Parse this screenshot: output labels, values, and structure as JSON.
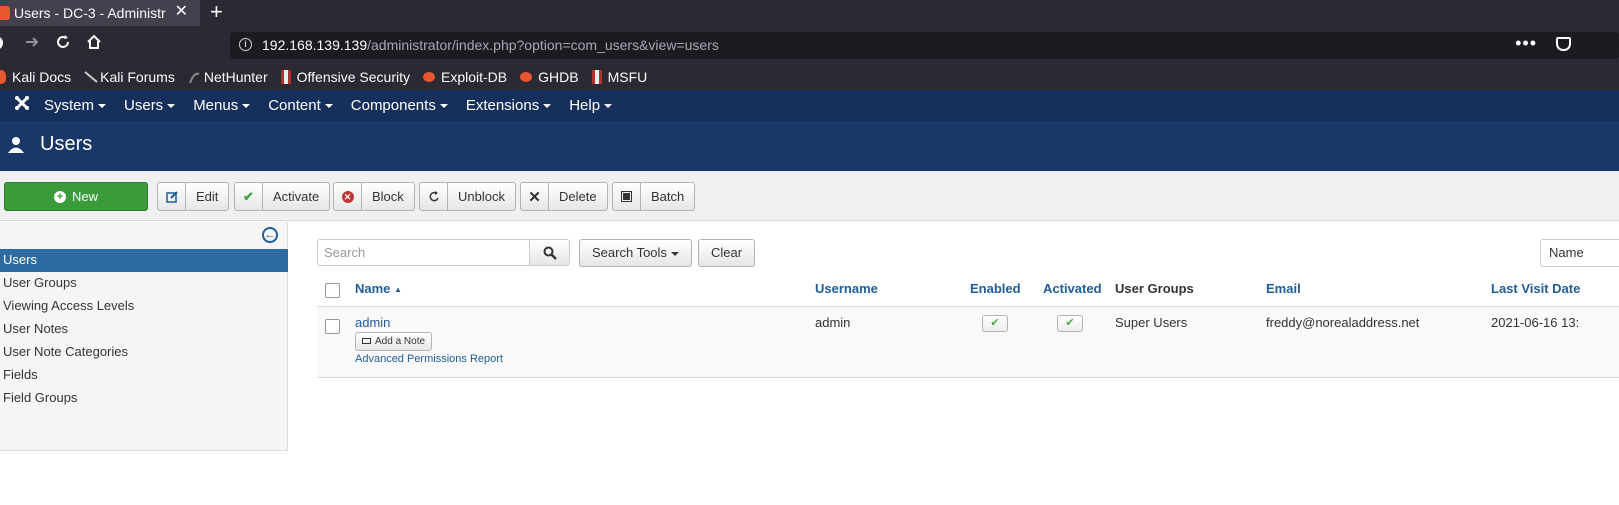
{
  "browser": {
    "tab_title": "Users - DC-3 - Administr",
    "tab_close": "✕",
    "new_tab": "+",
    "url_host": "192.168.139.139",
    "url_path": "/administrator/index.php?option=com_users&view=users",
    "bookmarks": [
      {
        "label": "Kali Docs",
        "color": "#e8572f"
      },
      {
        "label": "Kali Forums",
        "color": "#cccccc"
      },
      {
        "label": "NetHunter",
        "color": "#888888"
      },
      {
        "label": "Offensive Security",
        "color": "#b03030"
      },
      {
        "label": "Exploit-DB",
        "color": "#e8572f"
      },
      {
        "label": "GHDB",
        "color": "#e8572f"
      },
      {
        "label": "MSFU",
        "color": "#b03030"
      }
    ]
  },
  "joomla": {
    "menu": [
      "System",
      "Users",
      "Menus",
      "Content",
      "Components",
      "Extensions",
      "Help"
    ],
    "page_title": "Users",
    "toolbar": {
      "new": "New",
      "edit": "Edit",
      "activate": "Activate",
      "block": "Block",
      "unblock": "Unblock",
      "delete": "Delete",
      "batch": "Batch"
    },
    "sidebar": [
      "Users",
      "User Groups",
      "Viewing Access Levels",
      "User Notes",
      "User Note Categories",
      "Fields",
      "Field Groups"
    ],
    "search": {
      "placeholder": "Search",
      "tools_label": "Search Tools",
      "clear_label": "Clear",
      "ordering_value": "Name"
    },
    "table": {
      "headers": {
        "name": "Name",
        "username": "Username",
        "enabled": "Enabled",
        "activated": "Activated",
        "user_groups": "User Groups",
        "email": "Email",
        "last_visit": "Last Visit Date"
      },
      "rows": [
        {
          "name": "admin",
          "add_note": "Add a Note",
          "permissions_link": "Advanced Permissions Report",
          "username": "admin",
          "user_groups": "Super Users",
          "email": "freddy@norealaddress.net",
          "last_visit": "2021-06-16 13:"
        }
      ]
    },
    "colors": {
      "header_dark": "#17305b",
      "title_bar": "#1a3867",
      "new_button": "#3a9b3a",
      "sidebar_active": "#2d6ca2",
      "link": "#1f5d99"
    }
  }
}
